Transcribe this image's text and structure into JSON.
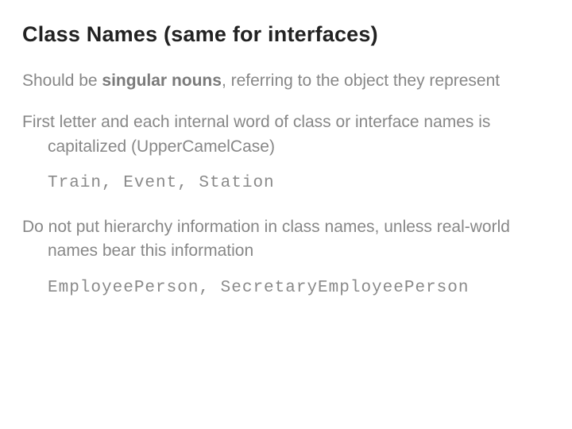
{
  "title": "Class Names (same for interfaces)",
  "p1a": "Should be ",
  "p1b": "singular nouns",
  "p1c": ", referring to the object they represent",
  "p2": "First letter and each internal word of class or interface names is capitalized (UpperCamelCase)",
  "code1": "Train, Event, Station",
  "p3": "Do not put hierarchy information in class names, unless real-world names bear this information",
  "code2": "EmployeePerson, SecretaryEmployeePerson"
}
